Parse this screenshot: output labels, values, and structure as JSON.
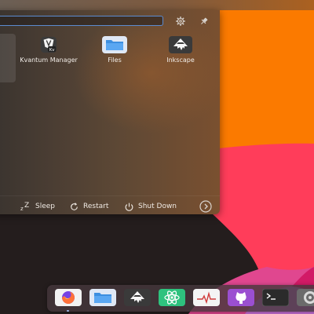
{
  "launcher": {
    "search": {
      "value": "",
      "placeholder": ""
    },
    "header_buttons": {
      "settings_icon": "gear-icon",
      "pin_icon": "pin-icon"
    },
    "apps": [
      {
        "label": "Kvantum Manager",
        "icon": "kvantum-icon"
      },
      {
        "label": "Files",
        "icon": "folder-icon"
      },
      {
        "label": "Inkscape",
        "icon": "inkscape-icon"
      }
    ],
    "footer": {
      "sleep_label": "Sleep",
      "restart_label": "Restart",
      "shutdown_label": "Shut Down",
      "more_icon": "chevron-right-icon"
    }
  },
  "dock": {
    "apps": [
      {
        "app": "Firefox",
        "icon": "firefox-icon",
        "running": true
      },
      {
        "app": "Files",
        "icon": "folder-icon",
        "running": false
      },
      {
        "app": "Inkscape",
        "icon": "inkscape-icon",
        "running": false
      },
      {
        "app": "Atom",
        "icon": "atom-icon",
        "running": false
      },
      {
        "app": "System Monitor",
        "icon": "system-monitor-icon",
        "running": false
      },
      {
        "app": "GitHub Desktop",
        "icon": "github-icon",
        "running": false
      },
      {
        "app": "Terminal",
        "icon": "terminal-icon",
        "running": false
      },
      {
        "app": "System Settings",
        "icon": "settings-icon",
        "running": false
      }
    ]
  },
  "colors": {
    "wallpaper_orange": "#fb7a00",
    "wallpaper_pink": "#ff3d5a",
    "wallpaper_magenta": "#e0478f",
    "wallpaper_lilac": "#c66fd6",
    "wallpaper_dark": "#241d1d",
    "search_focus": "#5b8bd0"
  }
}
